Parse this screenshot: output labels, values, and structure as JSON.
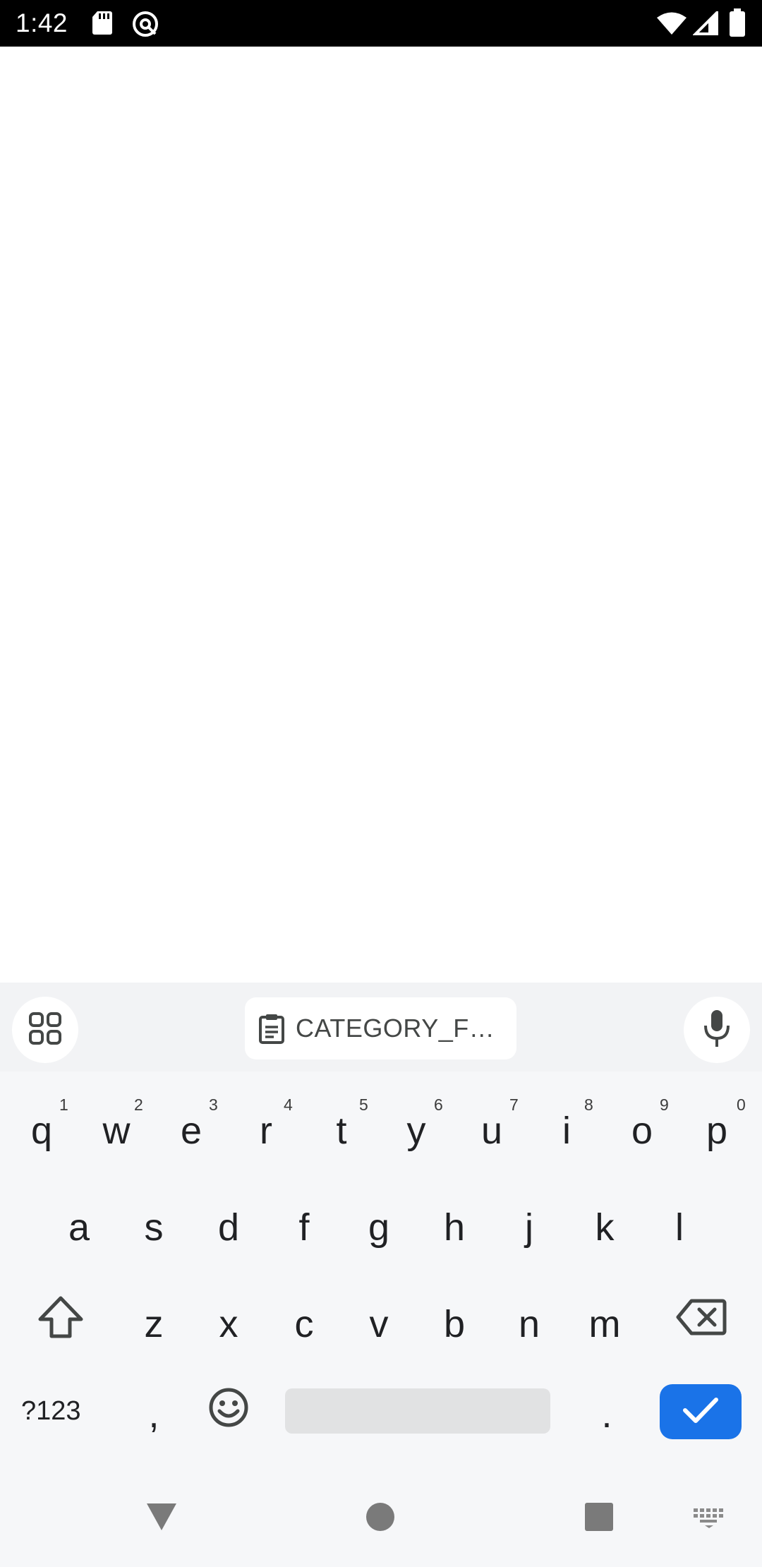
{
  "status_bar": {
    "time": "1:42",
    "icons": [
      "sd-card-icon",
      "vpn-icon",
      "wifi-icon",
      "signal-icon",
      "battery-icon"
    ]
  },
  "keyboard": {
    "suggestion_strip": {
      "clipboard_chip": "CATEGORY_F…",
      "icons": [
        "apps-grid-icon",
        "clipboard-icon",
        "mic-icon"
      ]
    },
    "row1": [
      {
        "key": "q",
        "hint": "1"
      },
      {
        "key": "w",
        "hint": "2"
      },
      {
        "key": "e",
        "hint": "3"
      },
      {
        "key": "r",
        "hint": "4"
      },
      {
        "key": "t",
        "hint": "5"
      },
      {
        "key": "y",
        "hint": "6"
      },
      {
        "key": "u",
        "hint": "7"
      },
      {
        "key": "i",
        "hint": "8"
      },
      {
        "key": "o",
        "hint": "9"
      },
      {
        "key": "p",
        "hint": "0"
      }
    ],
    "row2": [
      "a",
      "s",
      "d",
      "f",
      "g",
      "h",
      "j",
      "k",
      "l"
    ],
    "row3": [
      "z",
      "x",
      "c",
      "v",
      "b",
      "n",
      "m"
    ],
    "row4": {
      "symbols": "?123",
      "comma": ",",
      "period": "."
    },
    "accent_color": "#1a73e8"
  },
  "nav_bar": {
    "icons": [
      "back-icon",
      "home-icon",
      "recents-icon",
      "keyboard-switch-icon"
    ]
  }
}
